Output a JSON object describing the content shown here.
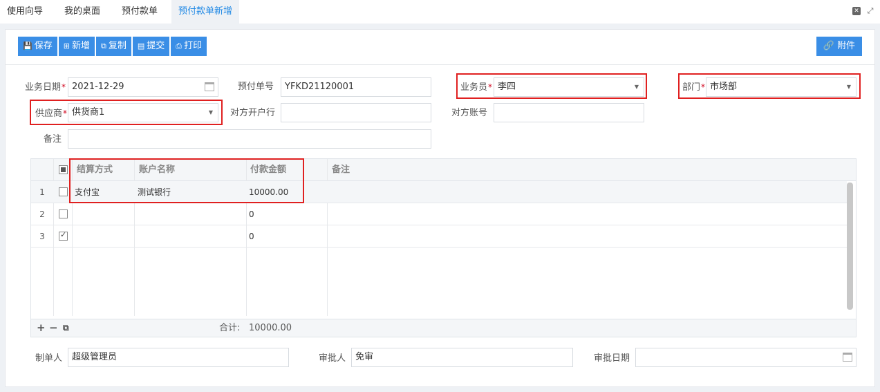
{
  "tabs": [
    "使用向导",
    "我的桌面",
    "预付款单",
    "预付款单新增"
  ],
  "toolbar": {
    "save": "保存",
    "add": "新增",
    "copy": "复制",
    "submit": "提交",
    "print": "打印",
    "attach": "附件"
  },
  "form": {
    "biz_date_label": "业务日期",
    "biz_date": "2021-12-29",
    "bill_no_label": "预付单号",
    "bill_no": "YFKD21120001",
    "salesman_label": "业务员",
    "salesman": "李四",
    "dept_label": "部门",
    "dept": "市场部",
    "supplier_label": "供应商",
    "supplier": "供货商1",
    "bank_label": "对方开户行",
    "bank": "",
    "account_label": "对方账号",
    "account": "",
    "remark_label": "备注",
    "remark": ""
  },
  "grid": {
    "columns": [
      "结算方式",
      "账户名称",
      "付款金额",
      "备注"
    ],
    "rows": [
      {
        "no": "1",
        "method": "支付宝",
        "account": "测试银行",
        "amount": "10000.00",
        "note": "",
        "checked": false
      },
      {
        "no": "2",
        "method": "",
        "account": "",
        "amount": "0",
        "note": "",
        "checked": false
      },
      {
        "no": "3",
        "method": "",
        "account": "",
        "amount": "0",
        "note": "",
        "checked": true
      }
    ],
    "total_label": "合计:",
    "total": "10000.00"
  },
  "footer": {
    "maker_label": "制单人",
    "maker": "超级管理员",
    "approver_label": "审批人",
    "approver": "免审",
    "approve_date_label": "审批日期",
    "approve_date": ""
  }
}
